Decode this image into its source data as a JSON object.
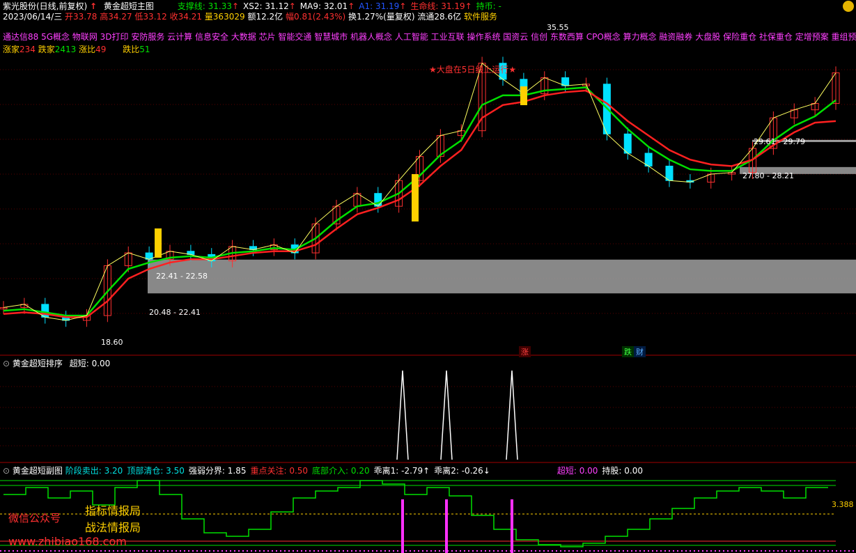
{
  "header": {
    "stock_name": "紫光股份(日线,前复权)",
    "up_arrow": "↑",
    "indicator_name": "黄金超短主图",
    "items": [
      {
        "label": "支撑线: 31.33",
        "arrow": "↑",
        "color": "#00e000"
      },
      {
        "label": "XS2: 31.12",
        "arrow": "↑",
        "color": "#ffffff"
      },
      {
        "label": "MA9: 32.01",
        "arrow": "↑",
        "color": "#ffffff"
      },
      {
        "label": "A1: 31.19",
        "arrow": "↑",
        "color": "#2255ff"
      },
      {
        "label": "生命线: 31.19",
        "arrow": "↑",
        "color": "#ff3030"
      },
      {
        "label": "持币: -",
        "arrow": "",
        "color": "#00e000"
      }
    ]
  },
  "quote": {
    "date": "2023/06/14/三",
    "open": "开33.78",
    "high": "高34.27",
    "low": "低33.12",
    "close": "收34.21",
    "volume": "量363029",
    "amount": "额12.2亿",
    "change": "幅0.81(2.43%)",
    "turnover": "换1.27%(量复权)",
    "float": "流通28.6亿",
    "industry": "软件服务"
  },
  "concepts": "通达信88 5G概念 物联网 3D打印 安防服务 云计算 信息安全 大数据 芯片 智能交通 智慧城市 机器人概念 人工智能 工业互联 操作系统 国资云 信创 东数西算 CPO概念 算力概念 融资融券 大盘股 保险重仓 社保重仓 定增预案 重组预案 高",
  "breadth": {
    "up_label": "涨家",
    "up_value": "234",
    "down_label": "跌家",
    "down_value": "2413",
    "ratio_up_label": "涨比",
    "ratio_up_value": "49",
    "ratio_down_label": "跌比",
    "ratio_down_value": "51"
  },
  "annotations": {
    "peak": "35.55",
    "low": "18.60",
    "market_note": "★大盘在5日线上运行★",
    "zone1_top": "22.41 - 22.58",
    "zone1_bottom": "20.48 - 22.41",
    "zone2_top": "29.61 - 29.79",
    "zone2_bottom": "27.80 - 28.21",
    "tag_zhang": "涨",
    "tag_die": "跌",
    "tag_cai": "财"
  },
  "panel2": {
    "title": "黄金超短排序",
    "value": "超短: 0.00"
  },
  "panel3": {
    "title": "黄金超短副图",
    "items": [
      {
        "label": "阶段卖出: 3.20",
        "color": "#00e0e0"
      },
      {
        "label": "顶部清仓: 3.50",
        "color": "#00e0e0"
      },
      {
        "label": "强弱分界: 1.85",
        "color": "#ffffff"
      },
      {
        "label": "重点关注: 0.50",
        "color": "#ff3030"
      },
      {
        "label": "底部介入: 0.20",
        "color": "#00e000"
      },
      {
        "label": "乖离1: -2.79↑",
        "color": "#ffffff"
      },
      {
        "label": "乖离2: -0.26↓",
        "color": "#ffffff"
      },
      {
        "label": "超短: 0.00",
        "color": "#ff40ff"
      },
      {
        "label": "持股: 0.00",
        "color": "#ffffff"
      }
    ],
    "value_label": "3.388"
  },
  "watermark": {
    "wechat": "微信公众号",
    "brand1": "指标情报局",
    "brand2": "战法情报局",
    "url": "www.zhibiao168.com"
  },
  "colors": {
    "up": "#ff3030",
    "down": "#00e0ff",
    "ma_green": "#00e000",
    "ma_red": "#ff2020",
    "zone": "#a0a0a0",
    "signal_yellow": "#ffd000",
    "spike": "#ff30ff"
  },
  "chart_data": {
    "type": "line",
    "title": "黄金超短主图",
    "x": [
      0,
      5,
      10,
      15,
      20,
      25,
      30,
      35,
      40,
      45,
      50,
      55,
      60,
      65,
      70,
      75,
      80,
      85,
      90,
      95,
      100,
      105,
      110,
      115,
      120,
      125,
      130,
      135,
      140,
      145,
      150,
      155,
      160,
      165,
      170,
      175,
      180,
      185,
      190,
      195,
      200
    ],
    "series": [
      {
        "name": "收盘",
        "values": [
          19.6,
          19.8,
          19.0,
          18.8,
          19.1,
          22.2,
          23.0,
          22.6,
          23.1,
          22.9,
          22.5,
          23.4,
          23.2,
          23.5,
          23.0,
          24.8,
          25.9,
          26.7,
          25.9,
          27.5,
          29.0,
          30.3,
          30.6,
          34.8,
          33.8,
          32.9,
          33.9,
          33.4,
          33.5,
          30.4,
          29.2,
          28.4,
          27.5,
          27.4,
          27.9,
          28.0,
          29.5,
          31.4,
          31.9,
          32.3,
          34.2
        ]
      },
      {
        "name": "支撑线",
        "values": [
          19.4,
          19.5,
          19.3,
          19.1,
          19.1,
          20.6,
          22.0,
          22.4,
          22.7,
          22.8,
          22.7,
          23.0,
          23.1,
          23.3,
          23.2,
          23.9,
          25.0,
          25.9,
          26.1,
          26.7,
          27.8,
          29.1,
          30.0,
          32.2,
          32.8,
          32.8,
          33.1,
          33.2,
          33.3,
          32.0,
          30.7,
          29.6,
          28.8,
          28.2,
          28.1,
          28.1,
          28.8,
          30.0,
          30.9,
          31.5,
          32.5
        ]
      },
      {
        "name": "生命线",
        "values": [
          19.2,
          19.3,
          19.2,
          19.0,
          19.0,
          20.0,
          21.4,
          22.0,
          22.4,
          22.6,
          22.6,
          22.8,
          23.0,
          23.1,
          23.1,
          23.5,
          24.5,
          25.4,
          25.8,
          26.3,
          27.2,
          28.4,
          29.4,
          31.4,
          32.2,
          32.4,
          32.8,
          33.0,
          33.1,
          32.3,
          31.2,
          30.3,
          29.4,
          28.8,
          28.5,
          28.4,
          28.8,
          29.7,
          30.5,
          31.1,
          31.2
        ]
      }
    ],
    "ylim": [
      17.5,
      37.0
    ],
    "xlabel": "",
    "ylabel": ""
  }
}
